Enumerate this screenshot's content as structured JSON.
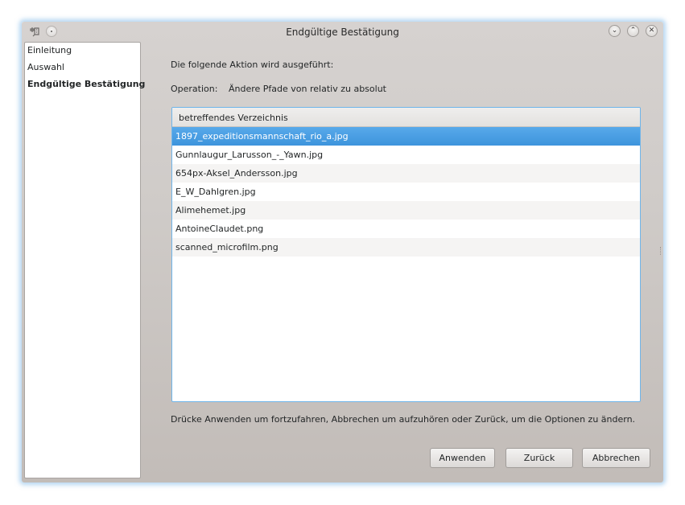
{
  "window": {
    "title": "Endgültige Bestätigung",
    "app_icon": "tool-icon",
    "controls": {
      "minimize": "⌄",
      "maximize": "⌃",
      "close": "✕"
    }
  },
  "sidebar": {
    "items": [
      {
        "label": "Einleitung",
        "active": false
      },
      {
        "label": "Auswahl",
        "active": false
      },
      {
        "label": "Endgültige Bestätigung",
        "active": true
      }
    ]
  },
  "main": {
    "intro": "Die folgende Aktion wird ausgeführt:",
    "operation_label": "Operation:",
    "operation_value": "Ändere Pfade von relativ zu absolut",
    "list": {
      "header": "betreffendes Verzeichnis",
      "items": [
        "1897_expeditionsmannschaft_rio_a.jpg",
        "Gunnlaugur_Larusson_-_Yawn.jpg",
        "654px-Aksel_Andersson.jpg",
        "E_W_Dahlgren.jpg",
        "Alimehemet.jpg",
        "AntoineClaudet.png",
        "scanned_microfilm.png"
      ],
      "selected_index": 0
    },
    "footer": "Drücke Anwenden um fortzufahren, Abbrechen um aufzuhören oder Zurück, um die Optionen zu ändern."
  },
  "buttons": {
    "apply": "Anwenden",
    "back": "Zurück",
    "cancel": "Abbrechen"
  },
  "colors": {
    "selection": "#3d94dc",
    "focus_border": "#6fb5ea",
    "window_glow": "#78b4e6"
  }
}
